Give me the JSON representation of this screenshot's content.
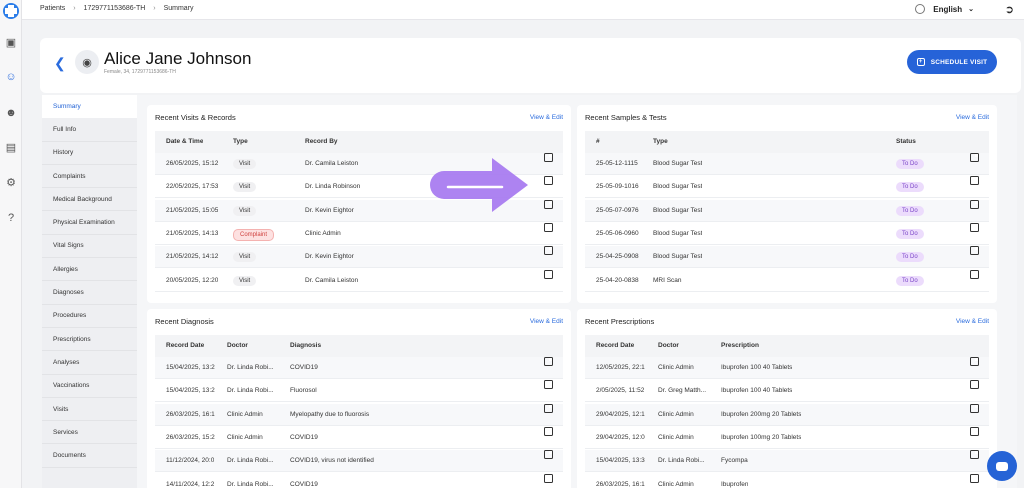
{
  "breadcrumbs": [
    "Patients",
    "1729771153686-TH",
    "Summary"
  ],
  "language": "English",
  "icons": {
    "rail": [
      "app-logo-icon",
      "dashboard-icon",
      "patient-icon",
      "users-icon",
      "document-icon",
      "settings-icon",
      "help-icon"
    ],
    "back": "back-arrow-icon",
    "camera": "camera-icon",
    "open": "external-link-icon"
  },
  "patient": {
    "name": "Alice Jane Johnson",
    "info": "Female, 34, 1729771153686-TH"
  },
  "schedule_label": "SCHEDULE VISIT",
  "nav": [
    "Summary",
    "Full Info",
    "History",
    "Complaints",
    "Medical Background",
    "Physical Examination",
    "Vital Signs",
    "Allergies",
    "Diagnoses",
    "Procedures",
    "Prescriptions",
    "Analyses",
    "Vaccinations",
    "Visits",
    "Services",
    "Documents"
  ],
  "visits": {
    "title": "Recent Visits & Records",
    "link": "View & Edit",
    "headers": [
      "Date & Time",
      "Type",
      "Record By"
    ],
    "rows": [
      {
        "date": "26/05/2025, 15:12",
        "type": "Visit",
        "by": "Dr. Camila Leiston"
      },
      {
        "date": "22/05/2025, 17:53",
        "type": "Visit",
        "by": "Dr. Linda Robinson"
      },
      {
        "date": "21/05/2025, 15:05",
        "type": "Visit",
        "by": "Dr. Kevin Eightor"
      },
      {
        "date": "21/05/2025, 14:13",
        "type": "Complaint",
        "by": "Clinic Admin"
      },
      {
        "date": "21/05/2025, 14:12",
        "type": "Visit",
        "by": "Dr. Kevin Eightor"
      },
      {
        "date": "20/05/2025, 12:20",
        "type": "Visit",
        "by": "Dr. Camila Leiston"
      }
    ]
  },
  "samples": {
    "title": "Recent Samples & Tests",
    "link": "View & Edit",
    "headers": [
      "#",
      "Type",
      "Status"
    ],
    "rows": [
      {
        "id": "25-05-12-1115",
        "type": "Blood Sugar Test",
        "status": "To Do"
      },
      {
        "id": "25-05-09-1016",
        "type": "Blood Sugar Test",
        "status": "To Do"
      },
      {
        "id": "25-05-07-0976",
        "type": "Blood Sugar Test",
        "status": "To Do"
      },
      {
        "id": "25-05-06-0960",
        "type": "Blood Sugar Test",
        "status": "To Do"
      },
      {
        "id": "25-04-25-0908",
        "type": "Blood Sugar Test",
        "status": "To Do"
      },
      {
        "id": "25-04-20-0838",
        "type": "MRI Scan",
        "status": "To Do"
      }
    ]
  },
  "diagnosis": {
    "title": "Recent Diagnosis",
    "link": "View & Edit",
    "headers": [
      "Record Date",
      "Doctor",
      "Diagnosis"
    ],
    "rows": [
      {
        "date": "15/04/2025, 13:2",
        "doctor": "Dr. Linda Robi...",
        "dx": "COVID19"
      },
      {
        "date": "15/04/2025, 13:2",
        "doctor": "Dr. Linda Robi...",
        "dx": "Fluorosol"
      },
      {
        "date": "26/03/2025, 16:1",
        "doctor": "Clinic Admin",
        "dx": "Myelopathy due to fluorosis"
      },
      {
        "date": "26/03/2025, 15:2",
        "doctor": "Clinic Admin",
        "dx": "COVID19"
      },
      {
        "date": "11/12/2024, 20:0",
        "doctor": "Dr. Linda Robi...",
        "dx": "COVID19, virus not identified"
      },
      {
        "date": "14/11/2024, 12:2",
        "doctor": "Dr. Linda Robi...",
        "dx": "COVID19"
      }
    ]
  },
  "prescriptions": {
    "title": "Recent Prescriptions",
    "link": "View & Edit",
    "headers": [
      "Record Date",
      "Doctor",
      "Prescription"
    ],
    "rows": [
      {
        "date": "12/05/2025, 22:1",
        "doctor": "Clinic Admin",
        "rx": "Ibuprofen 100 40 Tablets"
      },
      {
        "date": "2/05/2025, 11:52",
        "doctor": "Dr. Greg Matth...",
        "rx": "Ibuprofen 100 40 Tablets"
      },
      {
        "date": "29/04/2025, 12:1",
        "doctor": "Clinic Admin",
        "rx": "Ibuprofen 200mg 20 Tablets"
      },
      {
        "date": "29/04/2025, 12:0",
        "doctor": "Clinic Admin",
        "rx": "Ibuprofen 100mg 20 Tablets"
      },
      {
        "date": "15/04/2025, 13:3",
        "doctor": "Dr. Linda Robi...",
        "rx": "Fycompa"
      },
      {
        "date": "26/03/2025, 16:1",
        "doctor": "Clinic Admin",
        "rx": "Ibuprofen"
      }
    ]
  },
  "colors": {
    "accent": "#2663d8",
    "annotation_arrow": "#a678f0",
    "todo": "#7a44c8",
    "complaint": "#d0413f"
  }
}
